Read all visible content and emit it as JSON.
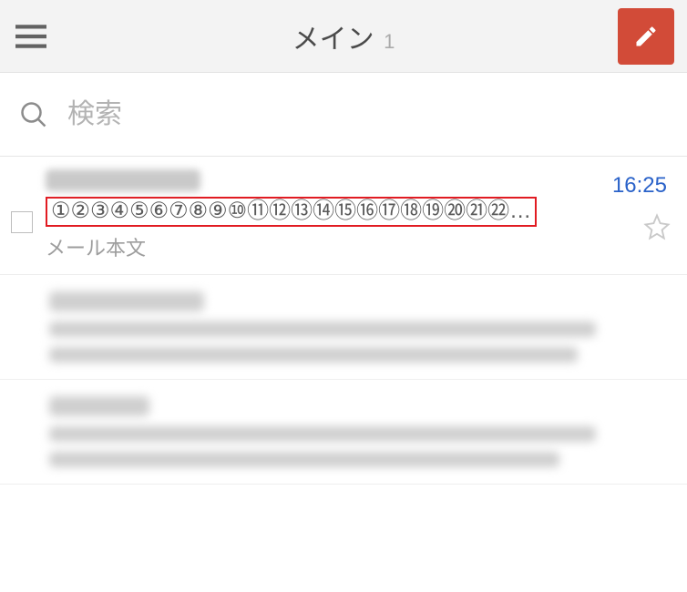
{
  "header": {
    "title": "メイン",
    "count": "1"
  },
  "search": {
    "placeholder": "検索",
    "value": ""
  },
  "items": [
    {
      "sender_visible": false,
      "subject": "①②③④⑤⑥⑦⑧⑨⑩⑪⑫⑬⑭⑮⑯⑰⑱⑲⑳㉑㉒…",
      "snippet": "メール本文",
      "time": "16:25",
      "starred": false,
      "highlighted": true
    }
  ]
}
